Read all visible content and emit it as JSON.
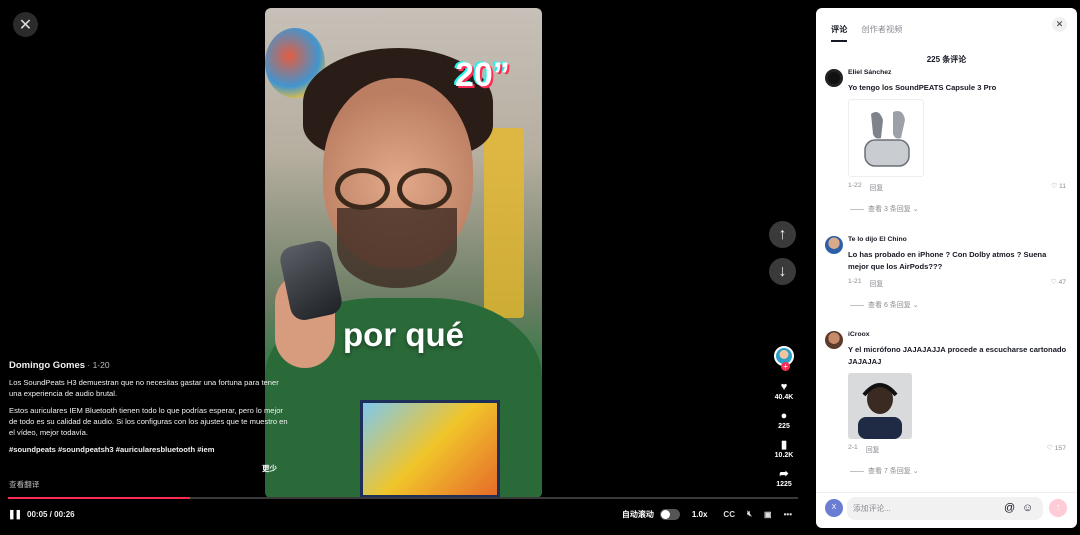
{
  "player": {
    "close_icon": "close-icon",
    "video_overlay_time": "20”",
    "video_caption": "por qué",
    "nav_up_icon": "arrow-up-icon",
    "nav_down_icon": "arrow-down-icon",
    "progress_percent": 23,
    "accent_color": "#fe2c55"
  },
  "actions": {
    "likes": "40.4K",
    "comments": "225",
    "saves": "10.2K",
    "shares": "1225"
  },
  "description": {
    "author": "Domingo Gomes",
    "date": " · 1-20",
    "para1": "Los SoundPeats H3 demuestran que no necesitas gastar una fortuna para tener una experiencia de audio brutal.",
    "para2": "Estos auriculares IEM Bluetooth tienen todo lo que podrías esperar, pero lo mejor de todo es su calidad de audio. Si los configuras con los ajustes que te muestro en el vídeo, mejor todavía.",
    "tags": "#soundpeats #soundpeatsh3 #auricularesbluetooth #iem",
    "less": "更少",
    "translate": "查看翻译"
  },
  "controls": {
    "time": "00:05 / 00:26",
    "autoplay": "自动滚动",
    "speed": "1.0x",
    "cc": "CC"
  },
  "panel": {
    "tabs": [
      "评论",
      "创作者视频"
    ],
    "count": "225 条评论",
    "comments": [
      {
        "name": "Eliel Sánchez",
        "text": "Yo tengo los SoundPEATS Capsule 3 Pro",
        "date": "1-22",
        "reply": "回复",
        "likes": "11",
        "more": "查看 3 条回复"
      },
      {
        "name": "Te lo dijo El Chino",
        "text": "Lo has probado en iPhone ? Con Dolby atmos ? Suena mejor que los AirPods???",
        "date": "1-21",
        "reply": "回复",
        "likes": "47",
        "more": "查看 6 条回复"
      },
      {
        "name": "iCroox",
        "text": "Y el micrófono JAJAJAJJA procede a escucharse cartonado JAJAJAJ",
        "date": "2-1",
        "reply": "回复",
        "likes": "157",
        "more": "查看 7 条回复"
      }
    ],
    "input_placeholder": "添加评论...",
    "me_initial": "X"
  }
}
